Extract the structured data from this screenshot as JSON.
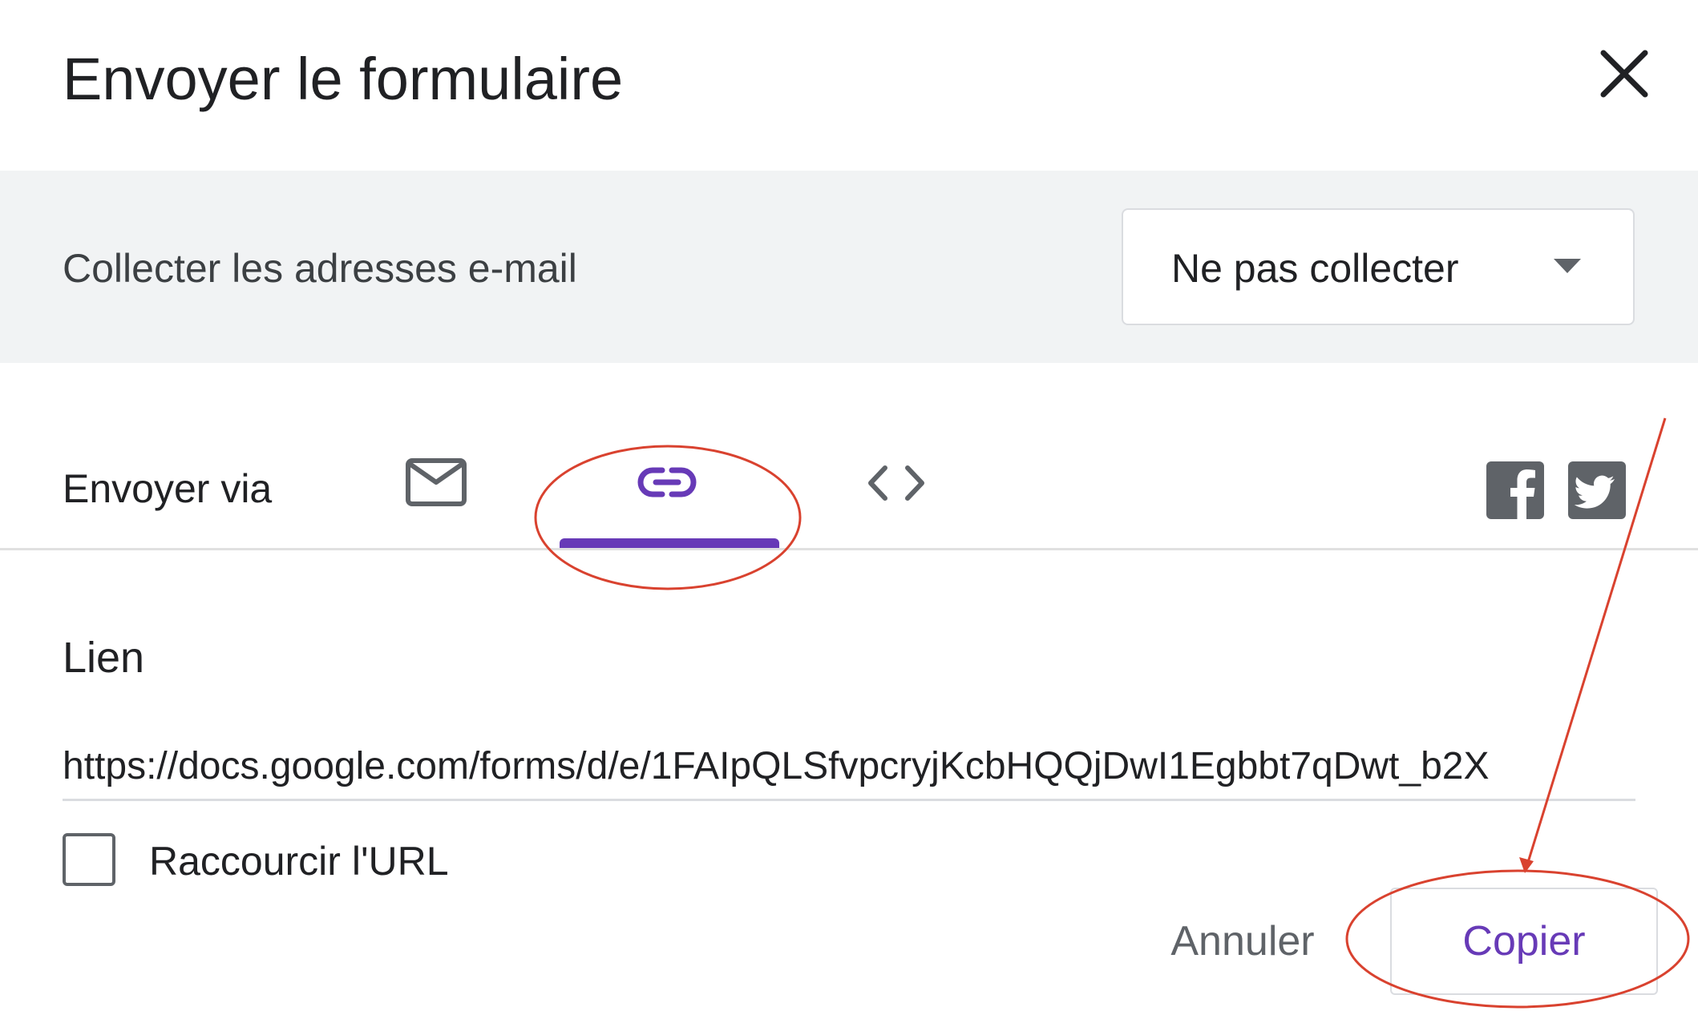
{
  "dialog": {
    "title": "Envoyer le formulaire"
  },
  "collect_emails": {
    "label": "Collecter les adresses e-mail",
    "selected": "Ne pas collecter"
  },
  "send_via": {
    "label": "Envoyer via",
    "tabs": [
      {
        "icon": "envelope-icon",
        "active": false
      },
      {
        "icon": "link-icon",
        "active": true
      },
      {
        "icon": "code-icon",
        "active": false
      }
    ],
    "share": [
      {
        "icon": "facebook-icon"
      },
      {
        "icon": "twitter-icon"
      }
    ]
  },
  "link_section": {
    "title": "Lien",
    "url": "https://docs.google.com/forms/d/e/1FAIpQLSfvpcryjKcbHQQjDwI1Egbbt7qDwt_b2X",
    "shorten_label": "Raccourcir l'URL",
    "shorten_checked": false
  },
  "actions": {
    "cancel_label": "Annuler",
    "copy_label": "Copier"
  },
  "colors": {
    "accent": "#673ab7",
    "annotation": "#d9422f",
    "band_background": "#f1f3f4"
  }
}
